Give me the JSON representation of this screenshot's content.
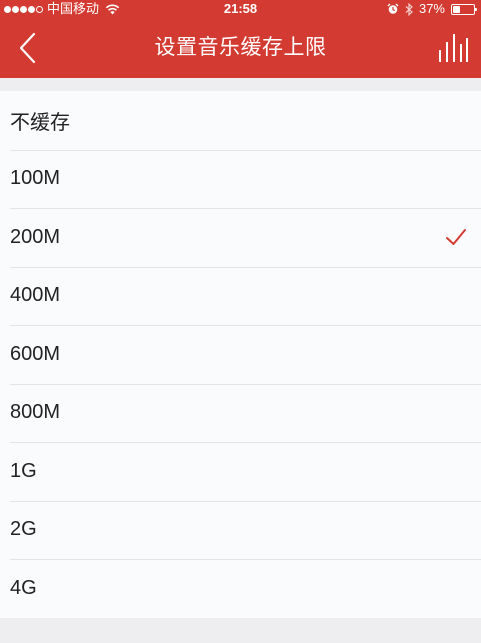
{
  "status_bar": {
    "carrier": "中国移动",
    "time": "21:58",
    "battery": "37%",
    "battery_level": 0.37,
    "signal_bars": 4,
    "icons": [
      "wifi-icon",
      "alarm-icon",
      "bluetooth-icon",
      "battery-icon"
    ]
  },
  "nav": {
    "title": "设置音乐缓存上限",
    "back_icon": "chevron-left-icon",
    "right_icon": "now-playing-bars-icon"
  },
  "colors": {
    "brand": "#d33a31",
    "check": "#d33a31",
    "background": "#eeeef0",
    "list_background": "#fafbfd"
  },
  "options": [
    {
      "label": "不缓存",
      "selected": false
    },
    {
      "label": "100M",
      "selected": false
    },
    {
      "label": "200M",
      "selected": true
    },
    {
      "label": "400M",
      "selected": false
    },
    {
      "label": "600M",
      "selected": false
    },
    {
      "label": "800M",
      "selected": false
    },
    {
      "label": "1G",
      "selected": false
    },
    {
      "label": "2G",
      "selected": false
    },
    {
      "label": "4G",
      "selected": false
    }
  ]
}
